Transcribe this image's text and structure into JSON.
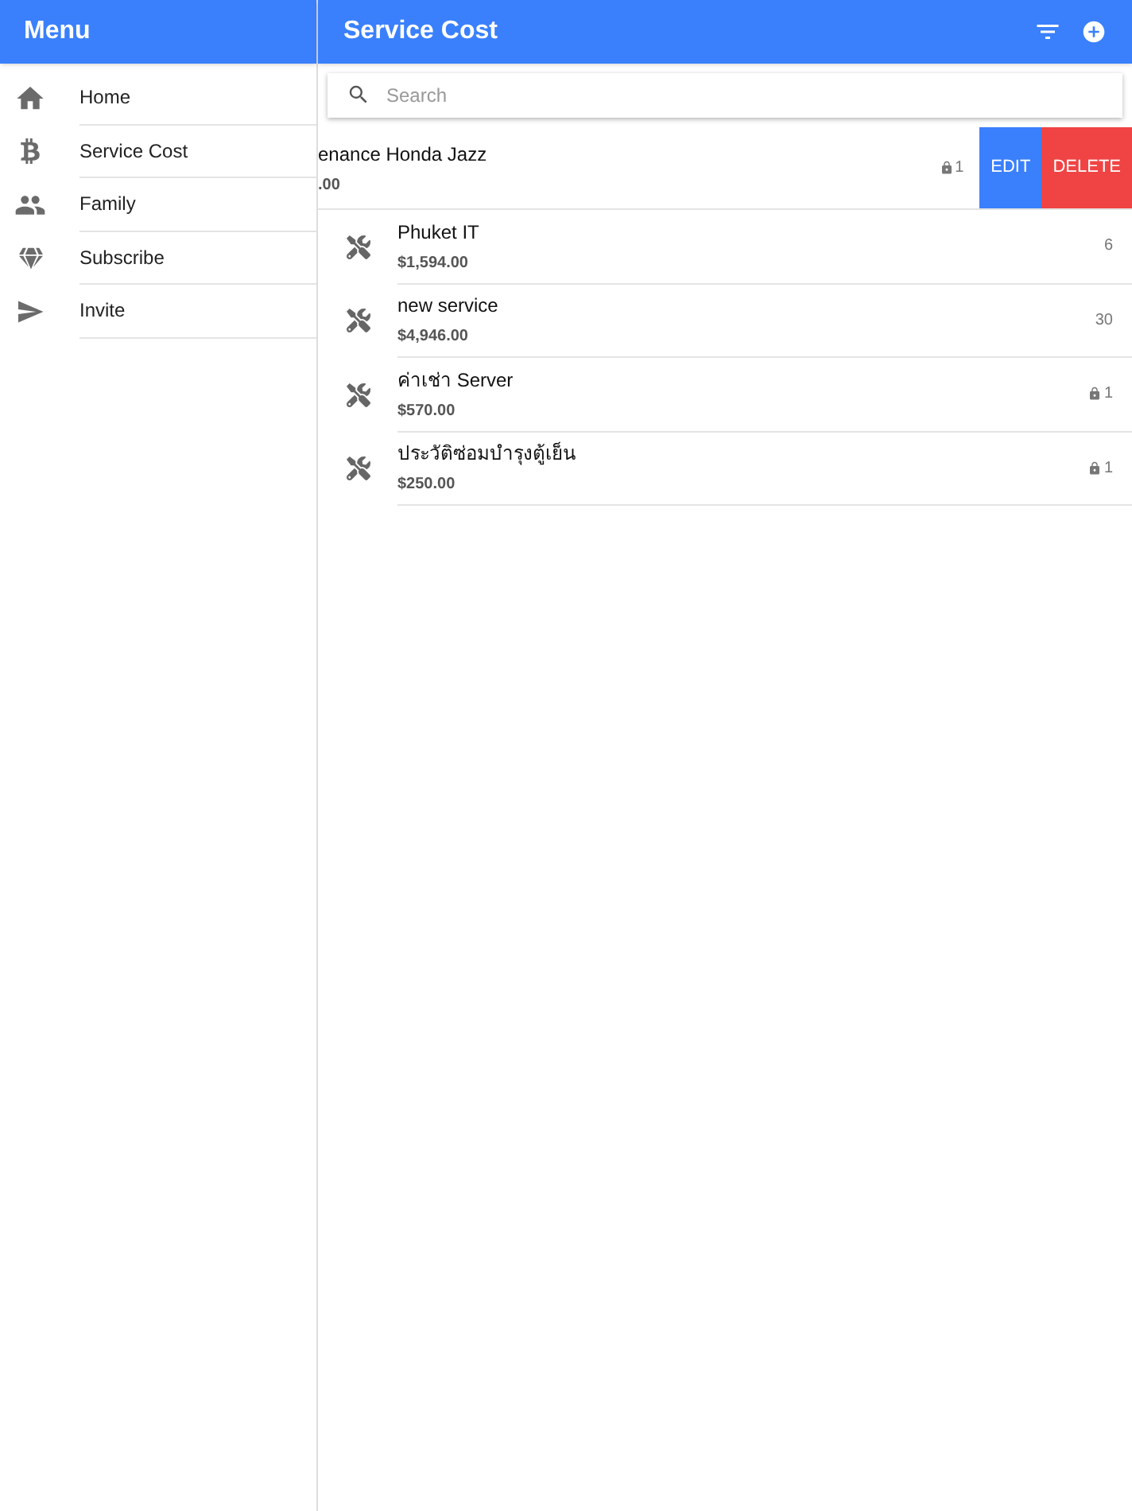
{
  "menu": {
    "title": "Menu",
    "items": [
      {
        "label": "Home",
        "kind": "home"
      },
      {
        "label": "Service Cost",
        "kind": "coin"
      },
      {
        "label": "Family",
        "kind": "people"
      },
      {
        "label": "Subscribe",
        "kind": "gem"
      },
      {
        "label": "Invite",
        "kind": "send"
      }
    ]
  },
  "header": {
    "title": "Service Cost"
  },
  "search": {
    "placeholder": "Search"
  },
  "rows": [
    {
      "kind": "swiped",
      "name": "enance Honda Jazz",
      "amount": ".00",
      "locked": true,
      "count": "1",
      "actions": [
        "EDIT",
        "DELETE"
      ]
    },
    {
      "kind": "normal",
      "name": "Phuket IT",
      "amount": "$1,594.00",
      "locked": false,
      "count": "6"
    },
    {
      "kind": "normal",
      "name": "new service",
      "amount": "$4,946.00",
      "locked": false,
      "count": "30"
    },
    {
      "kind": "normal",
      "name": "ค่าเช่า Server",
      "amount": "$570.00",
      "locked": true,
      "count": "1"
    },
    {
      "kind": "normal",
      "name": "ประวัติซ่อมบำรุงตู้เย็น",
      "amount": "$250.00",
      "locked": true,
      "count": "1"
    }
  ]
}
